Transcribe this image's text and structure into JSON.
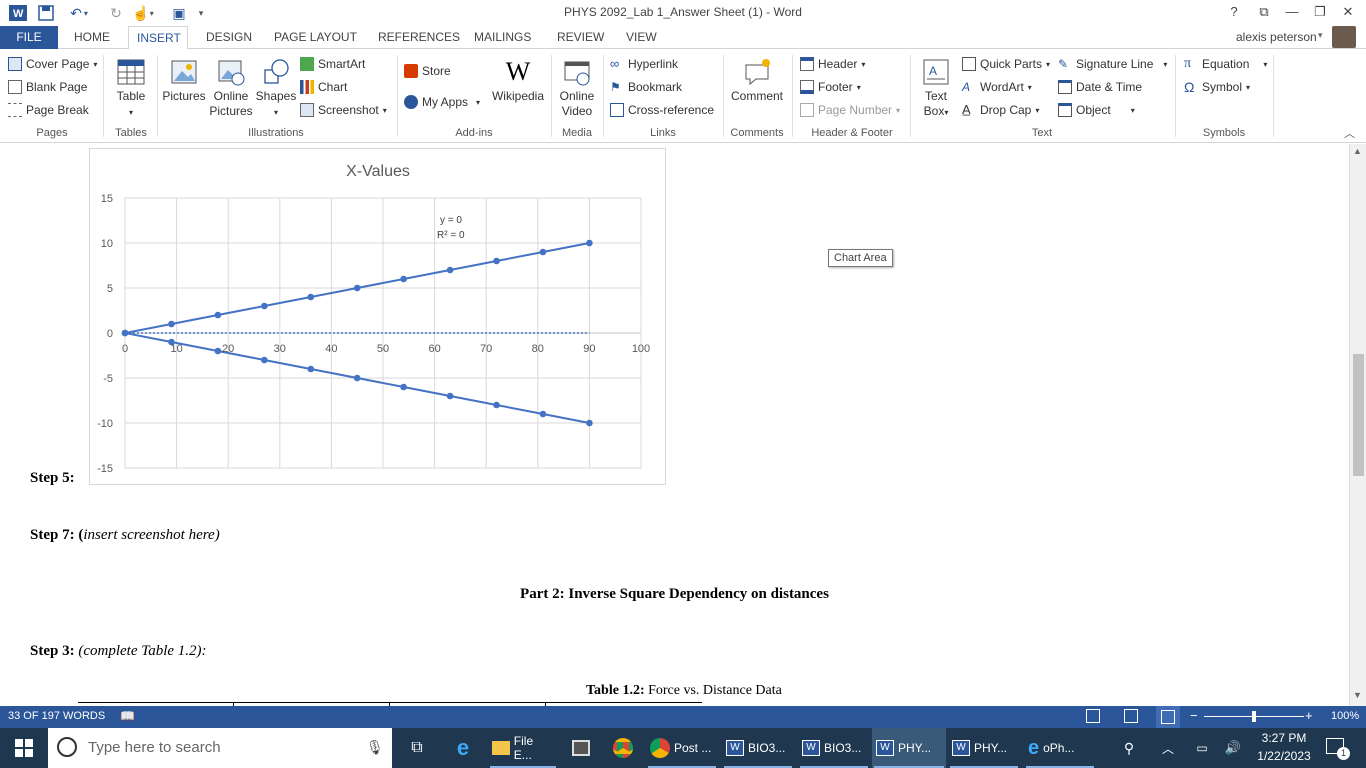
{
  "window": {
    "title": "PHYS 2092_Lab 1_Answer Sheet (1) - Word",
    "help": "?",
    "user": "alexis peterson"
  },
  "tabs": [
    "FILE",
    "HOME",
    "INSERT",
    "DESIGN",
    "PAGE LAYOUT",
    "REFERENCES",
    "MAILINGS",
    "REVIEW",
    "VIEW"
  ],
  "ribbon": {
    "pages": {
      "group": "Pages",
      "cover_page": "Cover Page",
      "blank_page": "Blank Page",
      "page_break": "Page Break"
    },
    "tables": {
      "group": "Tables",
      "table": "Table"
    },
    "illustrations": {
      "group": "Illustrations",
      "pictures": "Pictures",
      "online_pictures_1": "Online",
      "online_pictures_2": "Pictures",
      "shapes": "Shapes",
      "smartart": "SmartArt",
      "chart": "Chart",
      "screenshot": "Screenshot"
    },
    "addins": {
      "group": "Add-ins",
      "store": "Store",
      "my_apps": "My Apps",
      "wikipedia": "Wikipedia"
    },
    "media": {
      "group": "Media",
      "online_video_1": "Online",
      "online_video_2": "Video"
    },
    "links": {
      "group": "Links",
      "hyperlink": "Hyperlink",
      "bookmark": "Bookmark",
      "cross_reference": "Cross-reference"
    },
    "comments": {
      "group": "Comments",
      "comment": "Comment"
    },
    "header_footer": {
      "group": "Header & Footer",
      "header": "Header",
      "footer": "Footer",
      "page_number": "Page Number"
    },
    "text": {
      "group": "Text",
      "text_box_1": "Text",
      "text_box_2": "Box",
      "quick_parts": "Quick Parts",
      "wordart": "WordArt",
      "drop_cap": "Drop Cap",
      "signature_line": "Signature Line",
      "date_time": "Date & Time",
      "object": "Object"
    },
    "symbols": {
      "group": "Symbols",
      "equation": "Equation",
      "symbol": "Symbol"
    }
  },
  "document": {
    "step5": "Step 5:",
    "step7_label": "Step 7: (",
    "step7_note": "insert screenshot here)",
    "part2": "Part 2: Inverse Square Dependency on distances",
    "step3_label": "Step 3:",
    "step3_note": "(complete Table 1.2):",
    "table_caption_bold": "Table 1.2:",
    "table_caption_rest": " Force vs. Distance Data",
    "chart_tooltip": "Chart Area"
  },
  "chart_data": {
    "type": "line",
    "title": "X-Values",
    "x": [
      0,
      9,
      18,
      27,
      36,
      45,
      54,
      63,
      72,
      81,
      90
    ],
    "series": [
      {
        "values": [
          0,
          1,
          2,
          3,
          4,
          5,
          6,
          7,
          8,
          9,
          10
        ]
      },
      {
        "values": [
          0,
          -1,
          -2,
          -3,
          -4,
          -5,
          -6,
          -7,
          -8,
          -9,
          -10
        ]
      }
    ],
    "trendline": {
      "x": [
        0,
        90
      ],
      "y": [
        0,
        0
      ],
      "style": "dotted",
      "equation": "y = 0",
      "r2": "R² = 0"
    },
    "xlim": [
      0,
      100
    ],
    "ylim": [
      -15,
      15
    ],
    "xticks": [
      "0",
      "10",
      "20",
      "30",
      "40",
      "50",
      "60",
      "70",
      "80",
      "90",
      "100"
    ],
    "yticks": [
      "15",
      "10",
      "5",
      "0",
      "-5",
      "-10",
      "-15"
    ],
    "grid": true,
    "color": "#4472c4"
  },
  "status": {
    "words": "33 OF 197 WORDS",
    "zoom": "100%",
    "zoom_percent": 100
  },
  "taskbar": {
    "search_placeholder": "Type here to search",
    "apps": [
      "File E...",
      "Post ...",
      "BIO3...",
      "BIO3...",
      "PHY...",
      "PHY...",
      "oPh..."
    ],
    "time": "3:27 PM",
    "date": "1/22/2023",
    "notifications": "1"
  },
  "colors": {
    "word_blue": "#2b579a",
    "taskbar": "#1f3850",
    "chart_line": "#4472c4"
  }
}
